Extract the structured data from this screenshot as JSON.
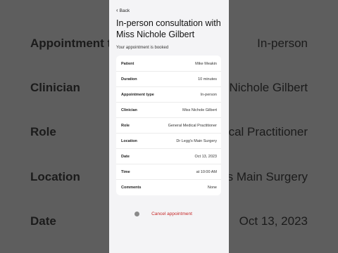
{
  "background": {
    "rows": [
      {
        "label": "Appointment t",
        "value": "In-person"
      },
      {
        "label": "Clinician",
        "value": "Nichole Gilbert"
      },
      {
        "label": "Role",
        "value": "cal Practitioner"
      },
      {
        "label": "Location",
        "value": "s Main Surgery"
      },
      {
        "label": "Date",
        "value": "Oct 13, 2023"
      }
    ]
  },
  "header": {
    "back_label": "Back",
    "title": "In-person consultation with Miss Nichole Gilbert",
    "subtitle": "Your appointment is booked"
  },
  "details": [
    {
      "label": "Patient",
      "value": "Mike Meakin"
    },
    {
      "label": "Duration",
      "value": "10 minutes"
    },
    {
      "label": "Appointment type",
      "value": "In-person"
    },
    {
      "label": "Clinician",
      "value": "Miss Nichole Gilbert"
    },
    {
      "label": "Role",
      "value": "General Medical Practitioner"
    },
    {
      "label": "Location",
      "value": "Dr Legg's Main Surgery"
    },
    {
      "label": "Date",
      "value": "Oct 13, 2023"
    },
    {
      "label": "Time",
      "value": "at 10:00 AM"
    },
    {
      "label": "Comments",
      "value": "None"
    }
  ],
  "actions": {
    "cancel_label": "Cancel appointment"
  },
  "colors": {
    "accent_danger": "#c62828",
    "panel_bg": "#f4f4f6",
    "card_bg": "#ffffff"
  }
}
